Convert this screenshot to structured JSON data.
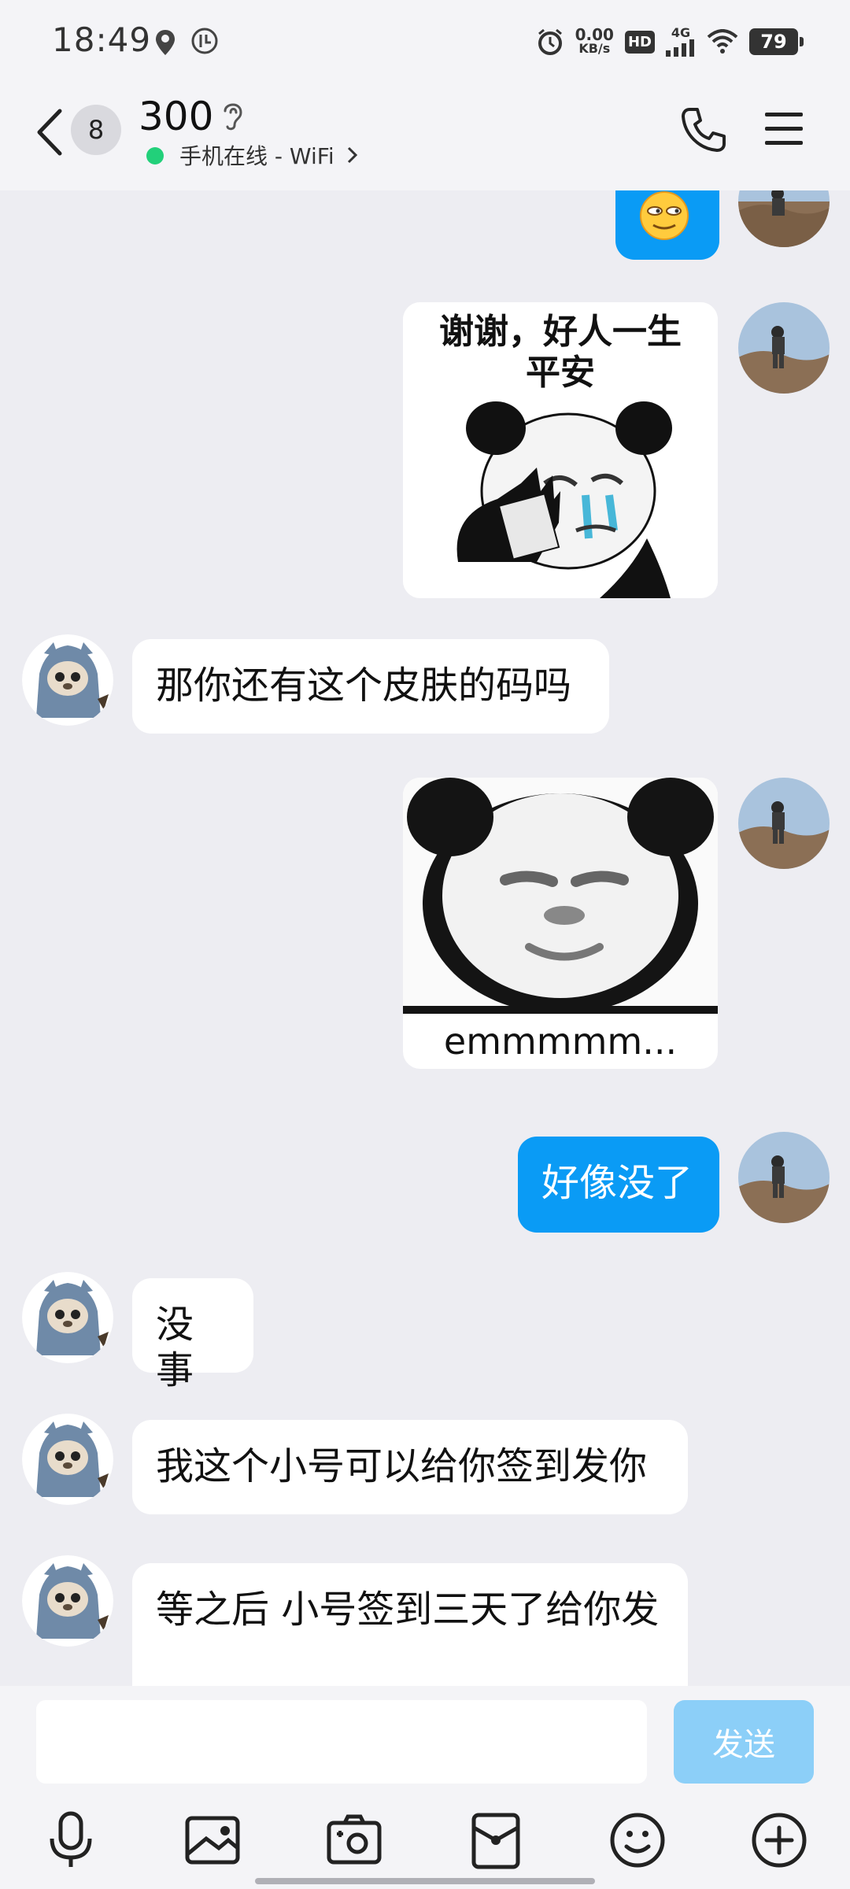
{
  "status_bar": {
    "time": "18:49",
    "net_speed_value": "0.00",
    "net_speed_unit": "KB/s",
    "hd_label": "HD",
    "network": "4G",
    "battery": "79"
  },
  "header": {
    "unread_count": "8",
    "contact_name": "300",
    "online_status": "手机在线 - WiFi"
  },
  "messages": [
    {
      "side": "right",
      "type": "emoji",
      "text": ""
    },
    {
      "side": "right",
      "type": "sticker",
      "text": "谢谢，好人一生平安"
    },
    {
      "side": "left",
      "type": "text",
      "text": "那你还有这个皮肤的码吗"
    },
    {
      "side": "right",
      "type": "sticker",
      "text": "emmmmm..."
    },
    {
      "side": "right",
      "type": "text",
      "text": "好像没了"
    },
    {
      "side": "left",
      "type": "text",
      "text": "没事"
    },
    {
      "side": "left",
      "type": "text",
      "text": "我这个小号可以给你签到发你"
    },
    {
      "side": "left",
      "type": "text",
      "text": "等之后 小号签到三天了给你发"
    }
  ],
  "sticker_text_line1": "谢谢，好人一生",
  "sticker_text_line2": "平安",
  "input": {
    "placeholder": "",
    "send_label": "发送"
  },
  "toolbar": [
    "mic-icon",
    "image-icon",
    "camera-icon",
    "red-packet-icon",
    "emoji-icon",
    "plus-icon"
  ],
  "colors": {
    "sent_bubble": "#0a9bf5",
    "received_bubble": "#ffffff",
    "background": "#ededf2",
    "send_button": "#8ccff8",
    "online_dot": "#22d07a"
  }
}
